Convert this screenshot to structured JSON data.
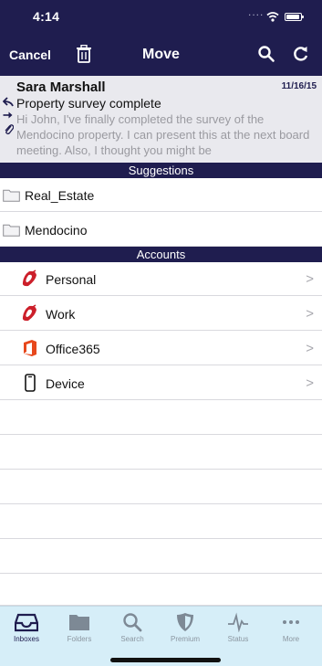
{
  "status_bar": {
    "time": "4:14",
    "signal": "...."
  },
  "nav": {
    "cancel_label": "Cancel",
    "title": "Move"
  },
  "message": {
    "sender": "Sara Marshall",
    "date": "11/16/15",
    "subject": "Property survey complete",
    "snippet": "Hi John, I've finally completed the survey of the Mendocino property. I can present this at the next board meeting. Also, I thought you might be"
  },
  "suggestions": {
    "header": "Suggestions",
    "items": [
      {
        "label": "Real_Estate",
        "icon": "folder-icon"
      },
      {
        "label": "Mendocino",
        "icon": "folder-icon"
      }
    ]
  },
  "accounts": {
    "header": "Accounts",
    "items": [
      {
        "label": "Personal",
        "icon": "account-logo-icon"
      },
      {
        "label": "Work",
        "icon": "account-logo-icon"
      },
      {
        "label": "Office365",
        "icon": "office365-icon"
      },
      {
        "label": "Device",
        "icon": "phone-icon"
      }
    ]
  },
  "tabbar": {
    "tabs": [
      {
        "label": "Inboxes",
        "icon": "inbox-icon",
        "active": true
      },
      {
        "label": "Folders",
        "icon": "folder-icon"
      },
      {
        "label": "Search",
        "icon": "search-icon"
      },
      {
        "label": "Premium",
        "icon": "shield-icon"
      },
      {
        "label": "Status",
        "icon": "pulse-icon"
      },
      {
        "label": "More",
        "icon": "more-icon"
      }
    ]
  },
  "colors": {
    "navy": "#1f1d4f",
    "preview_bg": "#e9e9ee",
    "tabbar_bg": "#d6eef8",
    "account_red": "#cc1f2a",
    "office_orange": "#e7481c"
  }
}
